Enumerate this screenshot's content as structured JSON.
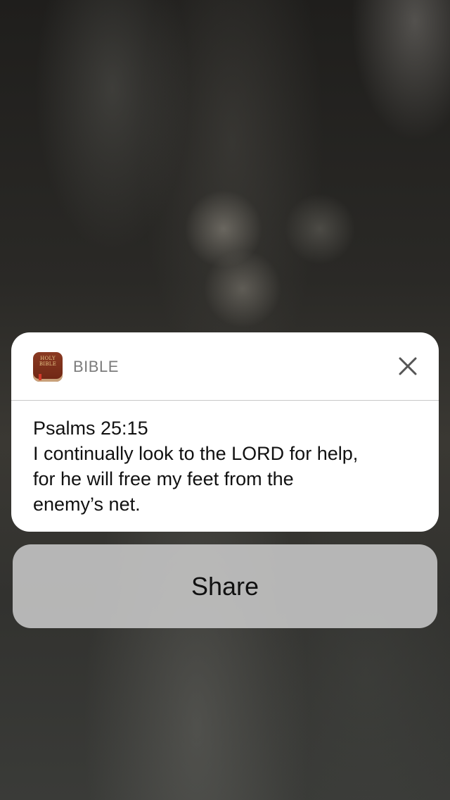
{
  "notification": {
    "app_icon": {
      "icon": "holy-bible-book-icon",
      "icon_text": "HOLY BIBLE",
      "color": "#7a2e1a"
    },
    "app_name": "BIBLE",
    "close_icon": "close-x-icon",
    "body": {
      "reference": "Psalms 25:15",
      "lines": [
        "I continually look to the LORD for help,",
        "for he will free my feet from the",
        "enemy’s net."
      ]
    }
  },
  "actions": {
    "share_label": "Share"
  }
}
